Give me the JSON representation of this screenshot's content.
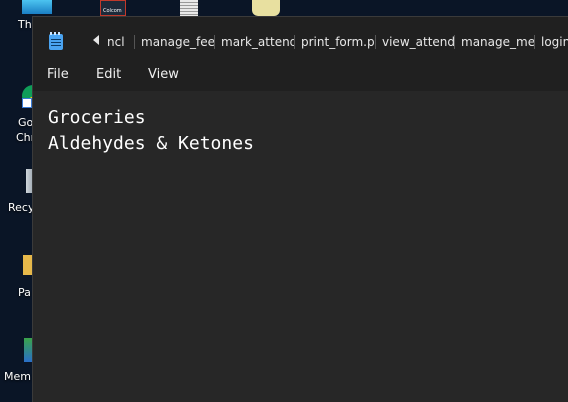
{
  "desktop": {
    "icons": [
      {
        "label": "Th"
      },
      {
        "label": "Go"
      },
      {
        "label": "Chr"
      },
      {
        "label": "Recy"
      },
      {
        "label": "Pa"
      },
      {
        "label": "Mem"
      }
    ],
    "top_icon_label": "Colcom"
  },
  "notepad": {
    "tabs": [
      {
        "label": "ncl"
      },
      {
        "label": "manage_fees"
      },
      {
        "label": "mark_attend"
      },
      {
        "label": "print_form.p"
      },
      {
        "label": "view_attenda"
      },
      {
        "label": "manage_mer"
      },
      {
        "label": "login"
      }
    ],
    "menu": {
      "file": "File",
      "edit": "Edit",
      "view": "View"
    },
    "content": {
      "line1": "Groceries",
      "line2": "Aldehydes & Ketones"
    }
  }
}
